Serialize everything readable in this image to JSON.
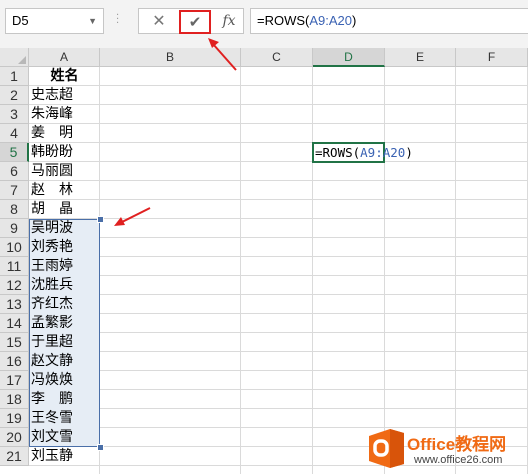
{
  "formula_bar": {
    "name_box": "D5",
    "cancel_icon": "✕",
    "enter_icon": "✔",
    "fx_icon": "fx",
    "formula_prefix": "=ROWS(",
    "formula_ref": "A9:A20",
    "formula_suffix": ")"
  },
  "columns": [
    "A",
    "B",
    "C",
    "D",
    "E",
    "F"
  ],
  "active_column": "D",
  "rows": [
    "1",
    "2",
    "3",
    "4",
    "5",
    "6",
    "7",
    "8",
    "9",
    "10",
    "11",
    "12",
    "13",
    "14",
    "15",
    "16",
    "17",
    "18",
    "19",
    "20",
    "21"
  ],
  "active_row": "5",
  "column_a": {
    "header": "姓名",
    "names": [
      "史志超",
      "朱海峰",
      "姜　明",
      "韩盼盼",
      "马丽圆",
      "赵　林",
      "胡　晶",
      "吴明波",
      "刘秀艳",
      "王雨婷",
      "沈胜兵",
      "齐红杰",
      "孟繁影",
      "于里超",
      "赵文静",
      "冯焕焕",
      "李　鹏",
      "王冬雪",
      "刘文雪",
      "刘玉静"
    ]
  },
  "editing_cell": {
    "prefix": "=ROWS(",
    "ref": "A9:A20",
    "suffix": ")"
  },
  "colors": {
    "accent_green": "#217346",
    "reference_blue": "#3a62b3",
    "annotation_red": "#e02020",
    "logo_orange": "#f06a14"
  },
  "watermark": {
    "brand": "Office教程网",
    "url": "www.office26.com"
  }
}
